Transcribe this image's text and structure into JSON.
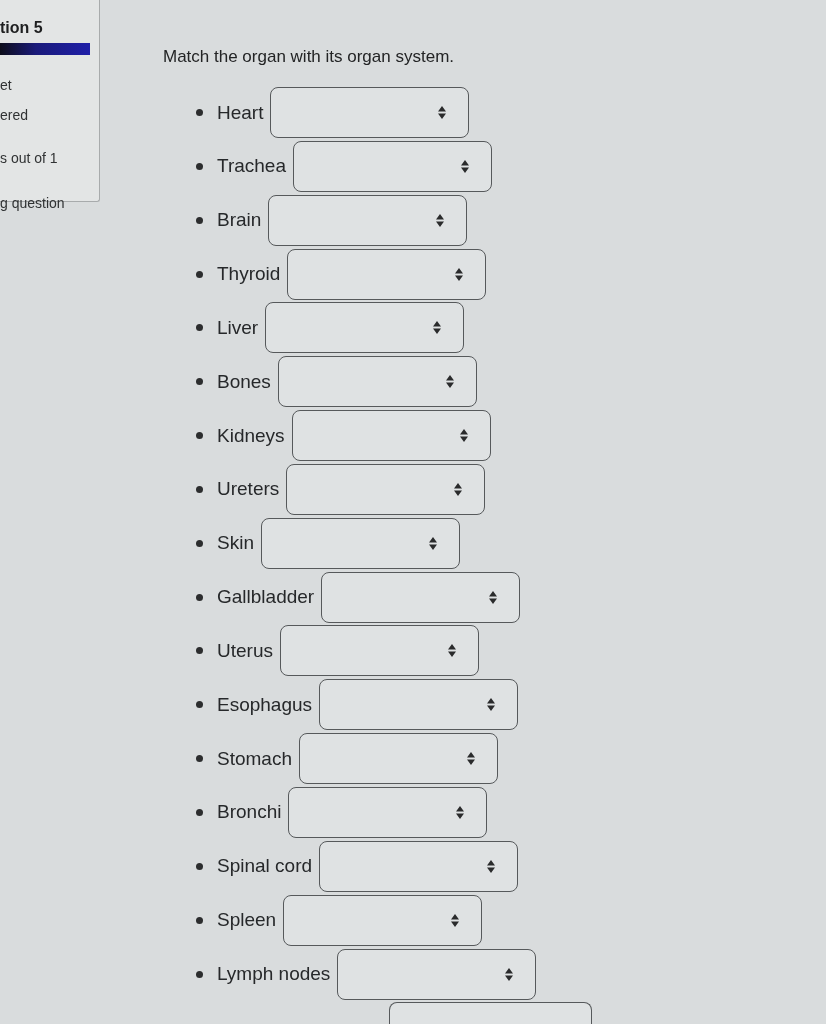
{
  "sidebar": {
    "title": "tion 5",
    "lines": [
      "et",
      "ered",
      "s out of 1",
      "g question"
    ]
  },
  "question": {
    "prompt": "Match the organ with its organ system.",
    "items": [
      {
        "kind": "select",
        "label": "Heart"
      },
      {
        "kind": "select",
        "label": "Trachea"
      },
      {
        "kind": "select",
        "label": "Brain"
      },
      {
        "kind": "select",
        "label": "Thyroid"
      },
      {
        "kind": "select",
        "label": "Liver"
      },
      {
        "kind": "select",
        "label": "Bones"
      },
      {
        "kind": "select",
        "label": "Kidneys"
      },
      {
        "kind": "select",
        "label": "Ureters"
      },
      {
        "kind": "select",
        "label": "Skin"
      },
      {
        "kind": "select",
        "label": "Gallbladder"
      },
      {
        "kind": "select",
        "label": "Uterus"
      },
      {
        "kind": "select",
        "label": "Esophagus"
      },
      {
        "kind": "select",
        "label": "Stomach"
      },
      {
        "kind": "select",
        "label": "Bronchi"
      },
      {
        "kind": "select",
        "label": "Spinal cord"
      },
      {
        "kind": "select",
        "label": "Spleen"
      },
      {
        "kind": "select",
        "label": "Lymph nodes"
      },
      {
        "kind": "partial"
      }
    ]
  }
}
